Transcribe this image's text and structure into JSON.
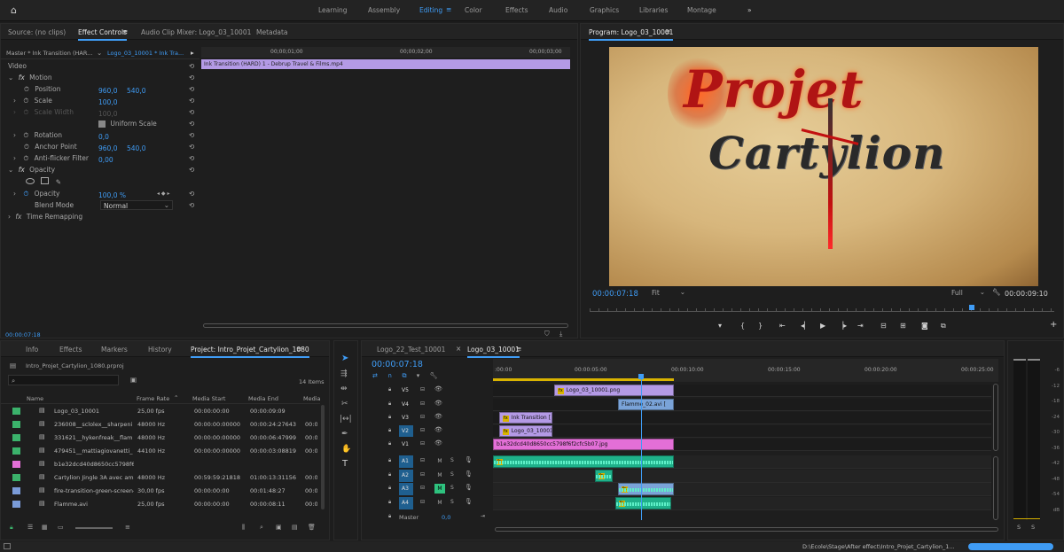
{
  "workspaces": {
    "items": [
      "Learning",
      "Assembly",
      "Editing",
      "Color",
      "Effects",
      "Audio",
      "Graphics",
      "Libraries",
      "Montage"
    ],
    "active": "Editing",
    "more": "»"
  },
  "source_tabs": {
    "source": "Source: (no clips)",
    "effect_controls": "Effect Controls",
    "mixer": "Audio Clip Mixer: Logo_03_10001",
    "metadata": "Metadata"
  },
  "ec": {
    "master_label": "Master * Ink Transition (HAR...",
    "clip_label": "Logo_03_10001 * Ink Tra...",
    "ruler": [
      "00;00;01;00",
      "00;00;02;00",
      "00;00;03;00"
    ],
    "clip_bar": "Ink Transition (HARD) 1 - Debrup Travel & Films.mp4",
    "video_label": "Video",
    "motion": "Motion",
    "position": {
      "label": "Position",
      "x": "960,0",
      "y": "540,0"
    },
    "scale": {
      "label": "Scale",
      "value": "100,0"
    },
    "scale_width": {
      "label": "Scale Width",
      "value": "100,0"
    },
    "uniform": "Uniform Scale",
    "rotation": {
      "label": "Rotation",
      "value": "0,0"
    },
    "anchor": {
      "label": "Anchor Point",
      "x": "960,0",
      "y": "540,0"
    },
    "antiflicker": {
      "label": "Anti-flicker Filter",
      "value": "0,00"
    },
    "opacity_group": "Opacity",
    "opacity": {
      "label": "Opacity",
      "value": "100,0 %"
    },
    "blend": {
      "label": "Blend Mode",
      "value": "Normal"
    },
    "time_remap": "Time Remapping",
    "timecode": "00:00:07:18"
  },
  "program": {
    "title": "Program: Logo_03_10001",
    "logo_line1": "Projet",
    "logo_line2": "Cartylion",
    "timecode": "00:00:07:18",
    "fit": "Fit",
    "quality": "Full",
    "duration": "00:00:09:10"
  },
  "project": {
    "tabs": [
      "Info",
      "Effects",
      "Markers",
      "History",
      "Project: Intro_Projet_Cartylion_1080"
    ],
    "file": "Intro_Projet_Cartylion_1080.prproj",
    "count": "14 Items",
    "columns": [
      "Name",
      "Frame Rate",
      "Media Start",
      "Media End",
      "Media"
    ],
    "rows": [
      {
        "color": "#3bb26b",
        "name": "Logo_03_10001",
        "rate": "25,00 fps",
        "start": "00:00:00:00",
        "end": "00:00:09:09",
        "media": ""
      },
      {
        "color": "#3bb26b",
        "name": "236008__sclolex__sharpeni",
        "rate": "48000 Hz",
        "start": "00:00:00:00000",
        "end": "00:00:24:27643",
        "media": "00:0"
      },
      {
        "color": "#3bb26b",
        "name": "331621__hykenfreak__flam",
        "rate": "48000 Hz",
        "start": "00:00:00:00000",
        "end": "00:00:06:47999",
        "media": "00:0"
      },
      {
        "color": "#3bb26b",
        "name": "479451__mattiagiovanetti_",
        "rate": "44100 Hz",
        "start": "00:00:00:00000",
        "end": "00:00:03:08819",
        "media": "00:0"
      },
      {
        "color": "#e36fd7",
        "name": "b1e32dcd40d8650cc5798f6f",
        "rate": "",
        "start": "",
        "end": "",
        "media": ""
      },
      {
        "color": "#3bb26b",
        "name": "Cartylion Jingle 3A avec am",
        "rate": "48000 Hz",
        "start": "00:59:59:21818",
        "end": "01:00:13:31156",
        "media": "00:0"
      },
      {
        "color": "#7a9bd8",
        "name": "fire-transition-green-screen-",
        "rate": "30,00 fps",
        "start": "00:00:00:00",
        "end": "00:01:48:27",
        "media": "00:0"
      },
      {
        "color": "#7a9bd8",
        "name": "Flamme.avi",
        "rate": "25,00 fps",
        "start": "00:00:00:00",
        "end": "00:00:08:11",
        "media": "00:0"
      }
    ]
  },
  "timeline": {
    "tabs": [
      "Logo_22_Test_10001",
      "Logo_03_10001"
    ],
    "timecode": "00:00:07:18",
    "ruler": [
      ":00:00",
      "00:00:05:00",
      "00:00:10:00",
      "00:00:15:00",
      "00:00:20:00",
      "00:00:25:00"
    ],
    "video_tracks": [
      "V5",
      "V4",
      "V3",
      "V2",
      "V1"
    ],
    "audio_tracks": [
      "A1",
      "A2",
      "A3",
      "A4"
    ],
    "master": "Master",
    "master_val": "0,0",
    "clips": {
      "v5": "Logo_03_10001.png",
      "v4": "Flamme_02.avi [",
      "v3": "Ink Transition [",
      "v2": "Logo_03_10001.",
      "v1": "b1e32dcd40d8650cc5798f6f2cfc5b07.jpg"
    }
  },
  "meter": {
    "ticks": [
      "-6",
      "-12",
      "-18",
      "-24",
      "-30",
      "-36",
      "-42",
      "-48",
      "-54",
      "dB"
    ],
    "solo": "S"
  },
  "status": {
    "path": "D:\\Ecole\\Stage\\After effect\\Intro_Projet_Cartylion_1..."
  },
  "colors": {
    "accent": "#3f9cf5",
    "v_clip": "#b49ae6",
    "v1_clip": "#e36fd7",
    "audio_clip": "#1fb08a",
    "audio_wave": "#5ff0c8",
    "blue_clip": "#7aa3d8"
  }
}
